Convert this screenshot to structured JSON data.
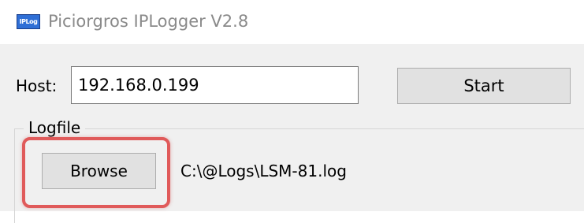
{
  "window": {
    "title": "Piciorgros IPLogger V2.8",
    "icon": "iplog-app-icon",
    "icon_text": "IPLog"
  },
  "host": {
    "label": "Host:",
    "value": "192.168.0.199"
  },
  "start_button": {
    "label": "Start"
  },
  "logfile": {
    "group_label": "Logfile",
    "browse_label": "Browse",
    "path": "C:\\@Logs\\LSM-81.log"
  },
  "colors": {
    "client_background": "#f0f0f0",
    "button_face": "#e1e1e1",
    "highlight_outline": "#e05a5a"
  }
}
